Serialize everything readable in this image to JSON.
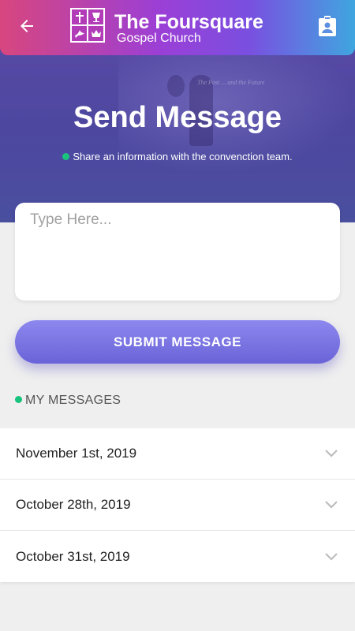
{
  "appbar": {
    "title": "The Foursquare",
    "subtitle": "Gospel Church",
    "back_icon": "arrow-left-icon",
    "action_icon": "clipboard-account-icon"
  },
  "hero": {
    "title": "Send Message",
    "subtitle": "Share an information with the convenction team.",
    "background_caption": "The Past ... and the Future"
  },
  "form": {
    "message_placeholder": "Type Here...",
    "message_value": "",
    "submit_label": "SUBMIT MESSAGE"
  },
  "messages": {
    "section_label": "MY MESSAGES",
    "items": [
      {
        "date": "November 1st, 2019"
      },
      {
        "date": "October 28th, 2019"
      },
      {
        "date": "October 31st, 2019"
      }
    ]
  },
  "colors": {
    "accent_green": "#19c37d",
    "button_purple": "#6a63d8",
    "appbar_start": "#d8467e",
    "appbar_end": "#3fa6e0"
  }
}
